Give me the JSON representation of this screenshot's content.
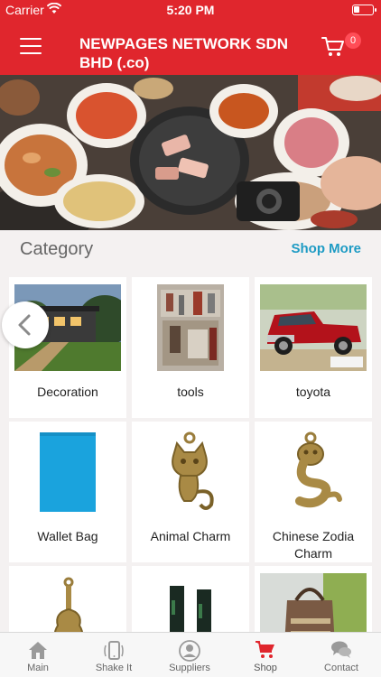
{
  "status_bar": {
    "carrier": "Carrier",
    "time": "5:20 PM",
    "wifi_icon": "wifi-icon",
    "battery_icon": "battery-icon"
  },
  "header": {
    "title": "NEWPAGES NETWORK SDN BHD (.co)",
    "menu_icon": "hamburger-menu-icon",
    "cart_icon": "shopping-cart-icon",
    "cart_count": "0",
    "color": "#e0262d"
  },
  "banner": {
    "description_icon": "food-banner-image"
  },
  "category": {
    "title": "Category",
    "shop_more": "Shop More",
    "link_color": "#1e9bc4",
    "items": [
      {
        "label": "Decoration"
      },
      {
        "label": "tools"
      },
      {
        "label": "toyota"
      },
      {
        "label": "Wallet Bag"
      },
      {
        "label": "Animal Charm"
      },
      {
        "label": "Chinese Zodia Charm"
      },
      {
        "label": ""
      },
      {
        "label": ""
      },
      {
        "label": ""
      }
    ]
  },
  "tab_bar": {
    "tabs": [
      {
        "label": "Main",
        "icon": "home-icon"
      },
      {
        "label": "Shake It",
        "icon": "shake-phone-icon"
      },
      {
        "label": "Suppliers",
        "icon": "user-icon"
      },
      {
        "label": "Shop",
        "icon": "shopping-cart-icon",
        "active": true
      },
      {
        "label": "Contact",
        "icon": "chat-bubbles-icon"
      }
    ],
    "active_color": "#e0262d"
  }
}
